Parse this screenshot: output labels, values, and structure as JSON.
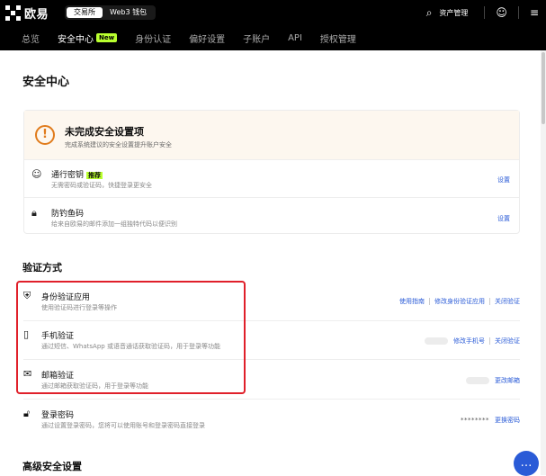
{
  "header": {
    "logo_text": "欧易",
    "switch": [
      "交易所",
      "Web3 钱包"
    ],
    "assets_label": "资产管理",
    "icons": [
      "search-icon",
      "user-icon",
      "menu-icon"
    ]
  },
  "subnav": {
    "tabs": [
      "总览",
      "安全中心",
      "身份认证",
      "偏好设置",
      "子账户",
      "API",
      "授权管理"
    ],
    "new_badge": "New"
  },
  "page": {
    "title": "安全中心"
  },
  "warning": {
    "title": "未完成安全设置项",
    "subtitle": "完成系统建议的安全设置提升账户安全",
    "items": [
      {
        "title": "通行密钥",
        "badge": "推荐",
        "subtitle": "无需密码或验证码，快捷登录更安全",
        "action": "设置"
      },
      {
        "title": "防钓鱼码",
        "subtitle": "给来自欧易的邮件添加一组独特代码以便识别",
        "action": "设置"
      }
    ]
  },
  "verification": {
    "section_title": "验证方式",
    "items": [
      {
        "title": "身份验证应用",
        "subtitle": "使用验证码进行登录等操作",
        "actions": [
          "使用指南",
          "修改身份验证应用",
          "关闭验证"
        ]
      },
      {
        "title": "手机验证",
        "subtitle": "通过短信、WhatsApp 或语音通话获取验证码，用于登录等功能",
        "actions": [
          "修改手机号",
          "关闭验证"
        ]
      },
      {
        "title": "邮箱验证",
        "subtitle": "通过邮箱获取验证码，用于登录等功能",
        "actions": [
          "更改邮箱"
        ]
      },
      {
        "title": "登录密码",
        "subtitle": "通过设置登录密码，您将可以使用账号和登录密码直接登录",
        "masked": "********",
        "actions": [
          "更换密码"
        ]
      }
    ]
  },
  "advanced": {
    "section_title": "高级安全设置"
  },
  "colors": {
    "accent_blue": "#2a5bd7",
    "new_green": "#b9ff2f",
    "warn_orange": "#e07b1c",
    "highlight_red": "#e0202a"
  }
}
